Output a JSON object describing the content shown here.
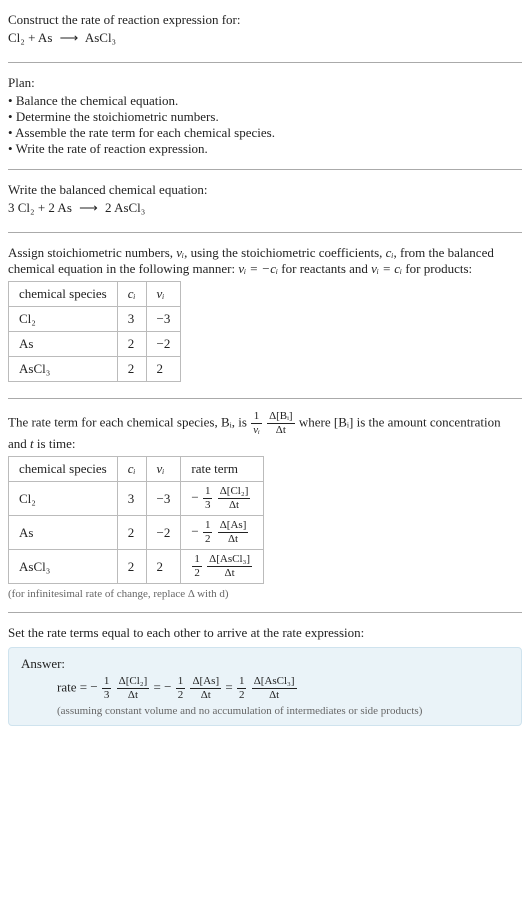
{
  "prompt": {
    "label": "Construct the rate of reaction expression for:",
    "equation": {
      "lhs": "Cl₂ + As",
      "arrow": "⟶",
      "rhs": "AsCl₃"
    }
  },
  "plan": {
    "label": "Plan:",
    "items": [
      "Balance the chemical equation.",
      "Determine the stoichiometric numbers.",
      "Assemble the rate term for each chemical species.",
      "Write the rate of reaction expression."
    ]
  },
  "balanced": {
    "label": "Write the balanced chemical equation:",
    "equation": {
      "lhs": "3 Cl₂ + 2 As",
      "arrow": "⟶",
      "rhs": "2 AsCl₃"
    }
  },
  "stoich": {
    "intro_pre": "Assign stoichiometric numbers, ",
    "nu_i": "νᵢ",
    "intro_mid1": ", using the stoichiometric coefficients, ",
    "c_i": "cᵢ",
    "intro_mid2": ", from the balanced chemical equation in the following manner: ",
    "reactants_eq": "νᵢ = −cᵢ",
    "products_eq": "νᵢ = cᵢ",
    "intro_reactants": " for reactants and ",
    "intro_products": " for products:",
    "headers": {
      "species": "chemical species",
      "ci": "cᵢ",
      "nui": "νᵢ"
    },
    "rows": [
      {
        "species": "Cl₂",
        "ci": "3",
        "nui": "−3"
      },
      {
        "species": "As",
        "ci": "2",
        "nui": "−2"
      },
      {
        "species": "AsCl₃",
        "ci": "2",
        "nui": "2"
      }
    ]
  },
  "rate_terms": {
    "intro_pre": "The rate term for each chemical species, ",
    "Bi": "Bᵢ",
    "intro_mid": ", is ",
    "coeff_num": "1",
    "coeff_den": "νᵢ",
    "delta_num": "Δ[Bᵢ]",
    "delta_den": "Δt",
    "intro_post1": " where ",
    "conc": "[Bᵢ]",
    "intro_post2": " is the amount concentration and ",
    "t": "t",
    "intro_post3": " is time:",
    "headers": {
      "species": "chemical species",
      "ci": "cᵢ",
      "nui": "νᵢ",
      "rate": "rate term"
    },
    "rows": [
      {
        "species": "Cl₂",
        "ci": "3",
        "nui": "−3",
        "sign": "−",
        "c_num": "1",
        "c_den": "3",
        "d_num": "Δ[Cl₂]",
        "d_den": "Δt"
      },
      {
        "species": "As",
        "ci": "2",
        "nui": "−2",
        "sign": "−",
        "c_num": "1",
        "c_den": "2",
        "d_num": "Δ[As]",
        "d_den": "Δt"
      },
      {
        "species": "AsCl₃",
        "ci": "2",
        "nui": "2",
        "sign": "",
        "c_num": "1",
        "c_den": "2",
        "d_num": "Δ[AsCl₃]",
        "d_den": "Δt"
      }
    ],
    "note": "(for infinitesimal rate of change, replace Δ with d)"
  },
  "final": {
    "label": "Set the rate terms equal to each other to arrive at the rate expression:"
  },
  "answer": {
    "label": "Answer:",
    "lead": "rate = ",
    "terms": [
      {
        "sign": "−",
        "c_num": "1",
        "c_den": "3",
        "d_num": "Δ[Cl₂]",
        "d_den": "Δt"
      },
      {
        "sign": "−",
        "c_num": "1",
        "c_den": "2",
        "d_num": "Δ[As]",
        "d_den": "Δt"
      },
      {
        "sign": "",
        "c_num": "1",
        "c_den": "2",
        "d_num": "Δ[AsCl₃]",
        "d_den": "Δt"
      }
    ],
    "eq": " = ",
    "note": "(assuming constant volume and no accumulation of intermediates or side products)"
  },
  "chart_data": {
    "type": "table",
    "species": [
      "Cl₂",
      "As",
      "AsCl₃"
    ],
    "c_i": [
      3,
      2,
      2
    ],
    "nu_i": [
      -3,
      -2,
      2
    ],
    "rate_terms_text": [
      "−(1/3) Δ[Cl₂]/Δt",
      "−(1/2) Δ[As]/Δt",
      "(1/2) Δ[AsCl₃]/Δt"
    ],
    "balanced_equation": "3 Cl₂ + 2 As ⟶ 2 AsCl₃",
    "rate_expression": "rate = −(1/3) Δ[Cl₂]/Δt = −(1/2) Δ[As]/Δt = (1/2) Δ[AsCl₃]/Δt"
  }
}
